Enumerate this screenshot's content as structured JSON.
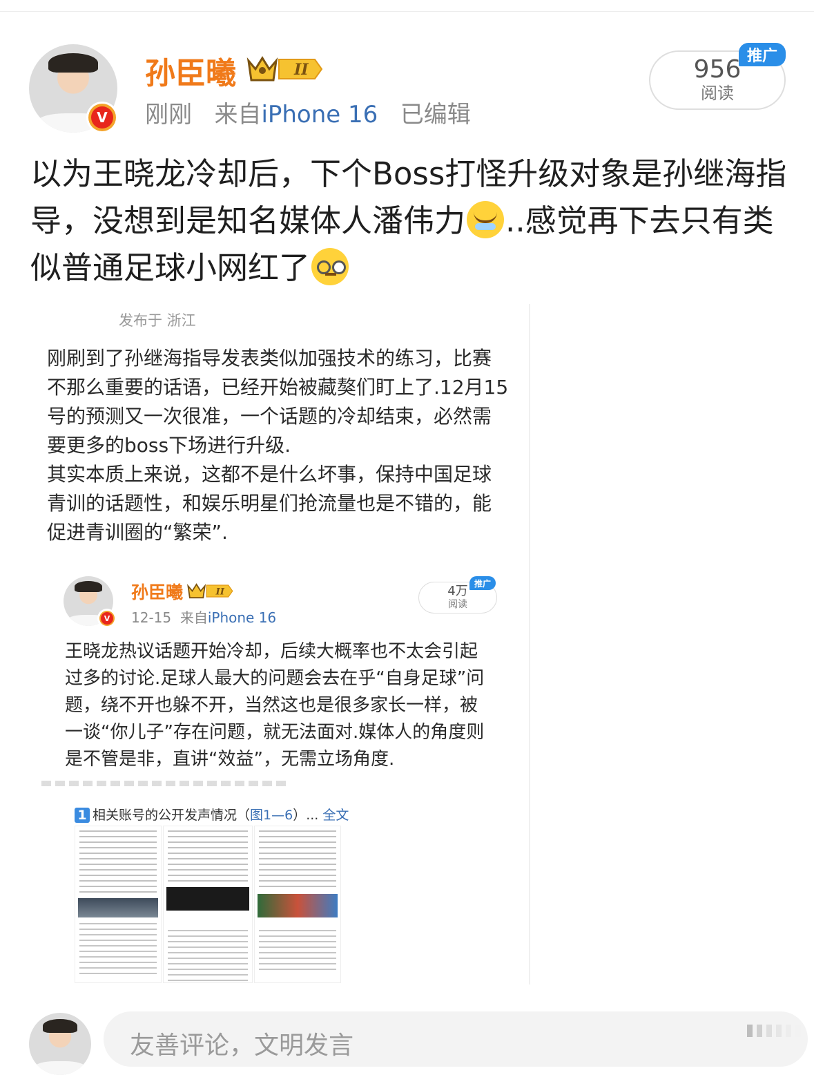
{
  "post": {
    "username": "孙臣曦",
    "level_badge": "II",
    "time": "刚刚",
    "source_prefix": "来自",
    "source_device": "iPhone 16",
    "edited": "已编辑",
    "reads_count": "956",
    "reads_label": "阅读",
    "promo_label": "推广",
    "text_part1": "以为王晓龙冷却后，下个Boss打怪升级对象是孙继海指导，没想到是知名媒体人潘伟力",
    "text_part2": "..感觉再下去只有类似普通足球小网红了",
    "emoji_1": "laugh-cry-emoji",
    "emoji_2": "blank-stare-emoji"
  },
  "screenshot": {
    "location": "发布于 浙江",
    "paragraph1": "刚刷到了孙继海指导发表类似加强技术的练习，比赛不那么重要的话语，已经开始被藏獒们盯上了.12月15号的预测又一次很准，一个话题的冷却结束，必然需要更多的boss下场进行升级.",
    "paragraph2": "其实本质上来说，这都不是什么坏事，保持中国足球青训的话题性，和娱乐明星们抢流量也是不错的，能促进青训圈的“繁荣”."
  },
  "quoted_post": {
    "username": "孙臣曦",
    "level_badge": "II",
    "time": "12-15",
    "source_prefix": "来自",
    "source_device": "iPhone 16",
    "reads_count": "4万",
    "reads_label": "阅读",
    "promo_label": "推广",
    "text": "王晓龙热议话题开始冷却，后续大概率也不太会引起过多的讨论.足球人最大的问题会去在乎“自身足球”问题，绕不开也躲不开，当然这也是很多家长一样，被一谈“你儿子”存在问题，就无法面对.媒体人的角度则是不管是非，直讲“效益”，无需立场角度."
  },
  "collage": {
    "number": "1",
    "title": "相关账号的公开发声情况",
    "ref_open": "（",
    "ref_link": "图1—6",
    "ref_close": "）...",
    "full_text": "全文"
  },
  "comment_bar": {
    "placeholder": "友善评论，文明发言"
  },
  "colors": {
    "username": "#f07a1a",
    "link": "#3a6fb4",
    "promo": "#2a8ee8",
    "verified": "#e8261c"
  }
}
